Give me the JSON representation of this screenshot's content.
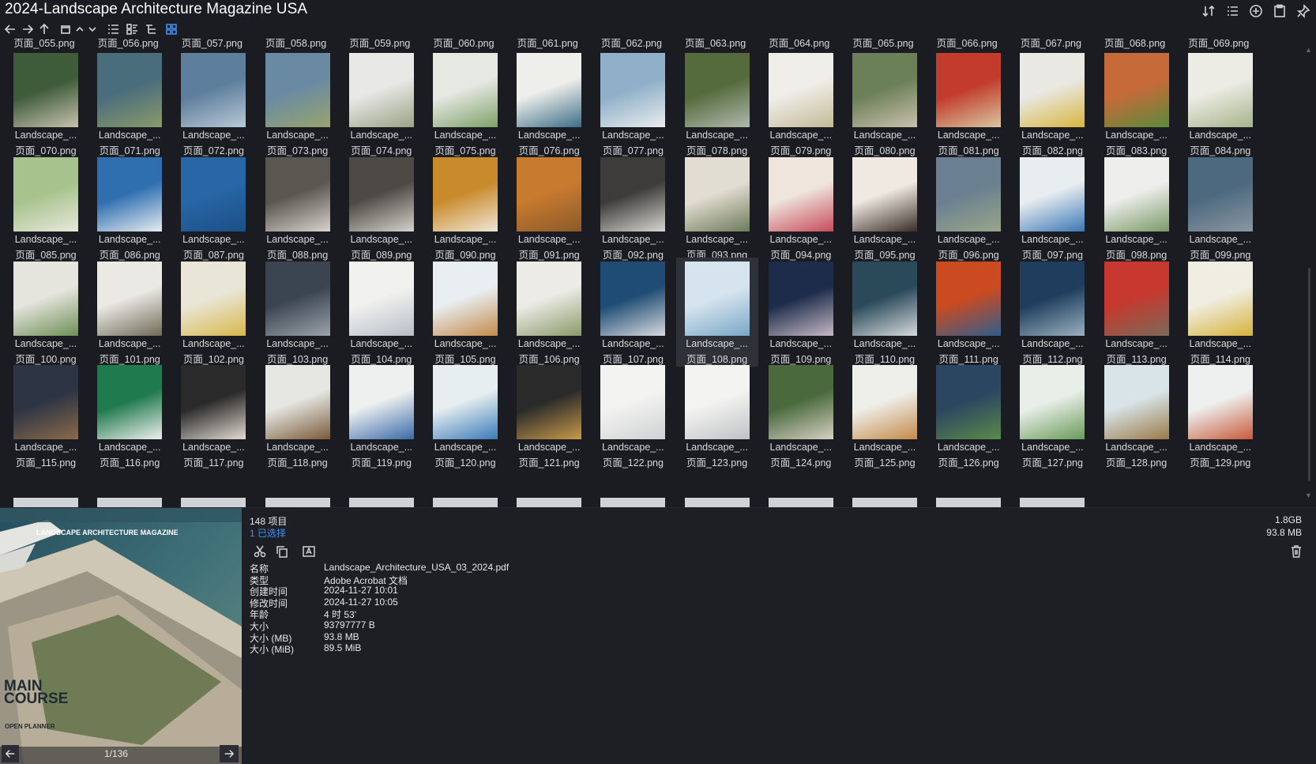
{
  "window": {
    "title": "2024-Landscape Architecture Magazine USA"
  },
  "icons": {
    "title_tools": [
      "sort-icon",
      "list-icon",
      "add-icon",
      "clipboard-icon",
      "pin-icon"
    ],
    "toolbar": [
      "back-arrow-icon",
      "forward-arrow-icon",
      "up-arrow-icon",
      "new-window-icon",
      "chevron-up-icon",
      "chevron-down-icon",
      "details-view-icon",
      "tiles-view-icon",
      "tree-view-icon",
      "grid-view-icon"
    ],
    "info_actions": [
      "cut-icon",
      "copy-icon",
      "rename-icon",
      "trash-icon"
    ]
  },
  "colors": {
    "accent": "#3f8ff0",
    "background": "#1a1c21",
    "selected_tile": "#2e3138"
  },
  "top_row_labels": [
    "页面_055.png",
    "页面_056.png",
    "页面_057.png",
    "页面_058.png",
    "页面_059.png",
    "页面_060.png",
    "页面_061.png",
    "页面_062.png",
    "页面_063.png",
    "页面_064.png",
    "页面_065.png",
    "页面_066.png",
    "页面_067.png",
    "页面_068.png",
    "页面_069.png"
  ],
  "tiles": [
    {
      "name": "Landscape_...",
      "page": "页面_070.png"
    },
    {
      "name": "Landscape_...",
      "page": "页面_071.png"
    },
    {
      "name": "Landscape_...",
      "page": "页面_072.png"
    },
    {
      "name": "Landscape_...",
      "page": "页面_073.png"
    },
    {
      "name": "Landscape_...",
      "page": "页面_074.png"
    },
    {
      "name": "Landscape_...",
      "page": "页面_075.png"
    },
    {
      "name": "Landscape_...",
      "page": "页面_076.png"
    },
    {
      "name": "Landscape_...",
      "page": "页面_077.png"
    },
    {
      "name": "Landscape_...",
      "page": "页面_078.png"
    },
    {
      "name": "Landscape_...",
      "page": "页面_079.png"
    },
    {
      "name": "Landscape_...",
      "page": "页面_080.png"
    },
    {
      "name": "Landscape_...",
      "page": "页面_081.png"
    },
    {
      "name": "Landscape_...",
      "page": "页面_082.png"
    },
    {
      "name": "Landscape_...",
      "page": "页面_083.png"
    },
    {
      "name": "Landscape_...",
      "page": "页面_084.png"
    },
    {
      "name": "Landscape_...",
      "page": "页面_085.png"
    },
    {
      "name": "Landscape_...",
      "page": "页面_086.png"
    },
    {
      "name": "Landscape_...",
      "page": "页面_087.png"
    },
    {
      "name": "Landscape_...",
      "page": "页面_088.png"
    },
    {
      "name": "Landscape_...",
      "page": "页面_089.png"
    },
    {
      "name": "Landscape_...",
      "page": "页面_090.png"
    },
    {
      "name": "Landscape_...",
      "page": "页面_091.png"
    },
    {
      "name": "Landscape_...",
      "page": "页面_092.png"
    },
    {
      "name": "Landscape_...",
      "page": "页面_093.png"
    },
    {
      "name": "Landscape_...",
      "page": "页面_094.png"
    },
    {
      "name": "Landscape_...",
      "page": "页面_095.png"
    },
    {
      "name": "Landscape_...",
      "page": "页面_096.png"
    },
    {
      "name": "Landscape_...",
      "page": "页面_097.png"
    },
    {
      "name": "Landscape_...",
      "page": "页面_098.png"
    },
    {
      "name": "Landscape_...",
      "page": "页面_099.png"
    },
    {
      "name": "Landscape_...",
      "page": "页面_100.png"
    },
    {
      "name": "Landscape_...",
      "page": "页面_101.png"
    },
    {
      "name": "Landscape_...",
      "page": "页面_102.png"
    },
    {
      "name": "Landscape_...",
      "page": "页面_103.png"
    },
    {
      "name": "Landscape_...",
      "page": "页面_104.png"
    },
    {
      "name": "Landscape_...",
      "page": "页面_105.png"
    },
    {
      "name": "Landscape_...",
      "page": "页面_106.png"
    },
    {
      "name": "Landscape_...",
      "page": "页面_107.png"
    },
    {
      "name": "Landscape_...",
      "page": "页面_108.png",
      "selected": true
    },
    {
      "name": "Landscape_...",
      "page": "页面_109.png"
    },
    {
      "name": "Landscape_...",
      "page": "页面_110.png"
    },
    {
      "name": "Landscape_...",
      "page": "页面_111.png"
    },
    {
      "name": "Landscape_...",
      "page": "页面_112.png"
    },
    {
      "name": "Landscape_...",
      "page": "页面_113.png"
    },
    {
      "name": "Landscape_...",
      "page": "页面_114.png"
    },
    {
      "name": "Landscape_...",
      "page": "页面_115.png"
    },
    {
      "name": "Landscape_...",
      "page": "页面_116.png"
    },
    {
      "name": "Landscape_...",
      "page": "页面_117.png"
    },
    {
      "name": "Landscape_...",
      "page": "页面_118.png"
    },
    {
      "name": "Landscape_...",
      "page": "页面_119.png"
    },
    {
      "name": "Landscape_...",
      "page": "页面_120.png"
    },
    {
      "name": "Landscape_...",
      "page": "页面_121.png"
    },
    {
      "name": "Landscape_...",
      "page": "页面_122.png"
    },
    {
      "name": "Landscape_...",
      "page": "页面_123.png"
    },
    {
      "name": "Landscape_...",
      "page": "页面_124.png"
    },
    {
      "name": "Landscape_...",
      "page": "页面_125.png"
    },
    {
      "name": "Landscape_...",
      "page": "页面_126.png"
    },
    {
      "name": "Landscape_...",
      "page": "页面_127.png"
    },
    {
      "name": "Landscape_...",
      "page": "页面_128.png"
    },
    {
      "name": "Landscape_...",
      "page": "页面_129.png"
    }
  ],
  "status": {
    "item_count": "148 项目",
    "selected_count": "1 已选择",
    "total_size": "1.8GB",
    "selected_size": "93.8 MB"
  },
  "details": [
    {
      "key": "名称",
      "value": "Landscape_Architecture_USA_03_2024.pdf"
    },
    {
      "key": "类型",
      "value": "Adobe Acrobat 文档"
    },
    {
      "key": "创建时间",
      "value": "2024-11-27  10:01"
    },
    {
      "key": "修改时间",
      "value": "2024-11-27  10:05"
    },
    {
      "key": "年龄",
      "value": "4 时 53'"
    },
    {
      "key": "大小",
      "value": "93797777 B"
    },
    {
      "key": "大小 (MB)",
      "value": "93.8 MB"
    },
    {
      "key": "大小 (MiB)",
      "value": "89.5 MiB"
    }
  ],
  "preview": {
    "magazine_header": "LANDSCAPE ARCHITECTURE MAGAZINE",
    "cover_headline_1": "MAIN",
    "cover_headline_2": "COURSE",
    "cover_sub": "OPEN PLANNER",
    "page_indicator": "1/136"
  }
}
